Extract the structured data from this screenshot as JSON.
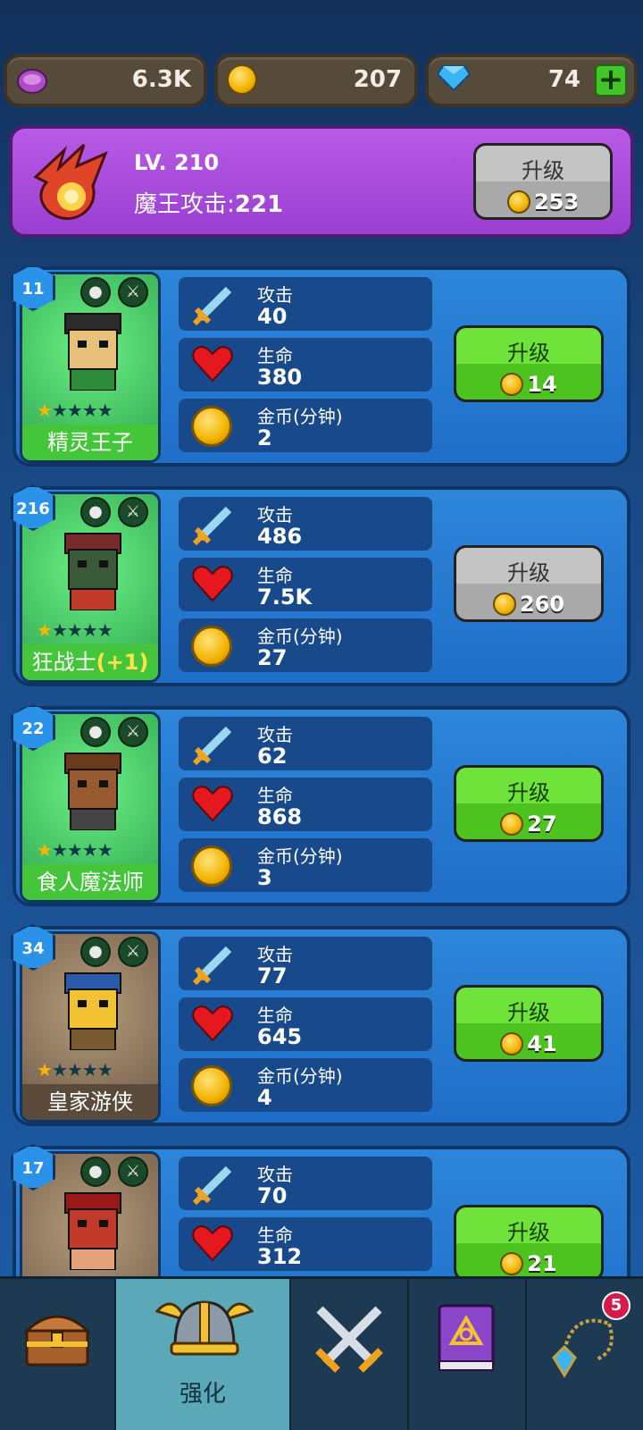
{
  "resources": {
    "purple_currency": "6.3K",
    "gold": "207",
    "gems": "74"
  },
  "banner": {
    "level": "LV. 210",
    "attack_label": "魔王攻击:",
    "attack_value": "221",
    "upgrade_label": "升级",
    "upgrade_cost": "253"
  },
  "labels": {
    "attack": "攻击",
    "life": "生命",
    "gold_per_min": "金币(分钟)",
    "upgrade": "升级"
  },
  "heroes": [
    {
      "level": "11",
      "name": "精灵王子",
      "bonus": "",
      "stars": 1,
      "attack": "40",
      "life": "380",
      "gold": "2",
      "cost": "14",
      "upgrade_enabled": true,
      "theme": "green"
    },
    {
      "level": "216",
      "name": "狂战士",
      "bonus": "(+1)",
      "stars": 1,
      "attack": "486",
      "life": "7.5K",
      "gold": "27",
      "cost": "260",
      "upgrade_enabled": false,
      "theme": "green"
    },
    {
      "level": "22",
      "name": "食人魔法师",
      "bonus": "",
      "stars": 1,
      "attack": "62",
      "life": "868",
      "gold": "3",
      "cost": "27",
      "upgrade_enabled": true,
      "theme": "green"
    },
    {
      "level": "34",
      "name": "皇家游侠",
      "bonus": "",
      "stars": 1,
      "attack": "77",
      "life": "645",
      "gold": "4",
      "cost": "41",
      "upgrade_enabled": true,
      "theme": "brown"
    },
    {
      "level": "17",
      "name": "",
      "bonus": "",
      "stars": 1,
      "attack": "70",
      "life": "312",
      "gold": "",
      "cost": "21",
      "upgrade_enabled": true,
      "theme": "brown"
    }
  ],
  "nav": {
    "tabs": [
      {
        "icon": "treasure-chest-icon",
        "label": ""
      },
      {
        "icon": "viking-helmet-icon",
        "label": "强化"
      },
      {
        "icon": "crossed-swords-icon",
        "label": ""
      },
      {
        "icon": "spellbook-icon",
        "label": ""
      },
      {
        "icon": "amulet-icon",
        "label": "",
        "badge": "5"
      }
    ]
  }
}
